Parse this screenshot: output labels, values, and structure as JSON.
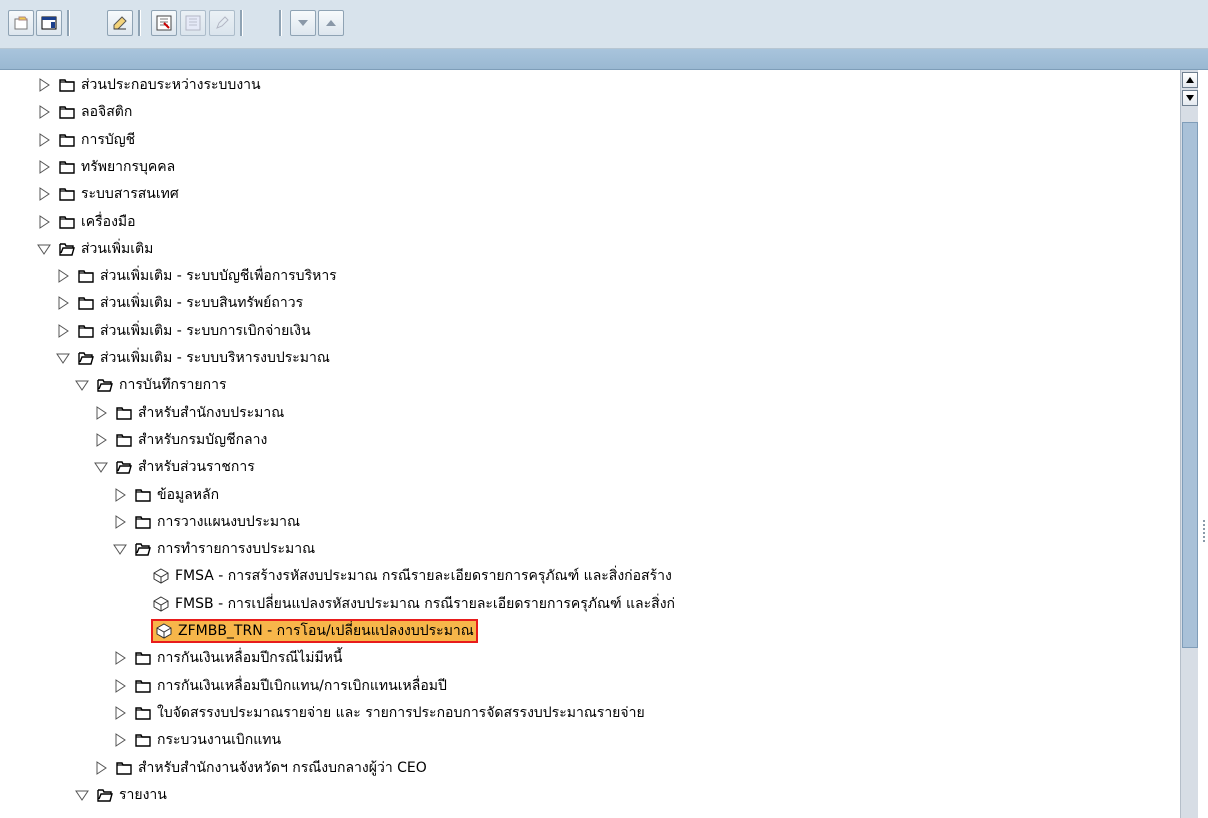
{
  "toolbar": {
    "buttons": [
      {
        "name": "open-folder-icon"
      },
      {
        "name": "favorites-icon"
      },
      {
        "name": "pencil-erase-icon"
      },
      {
        "name": "add-favorite-icon"
      },
      {
        "name": "change-favorite-icon"
      },
      {
        "name": "edit-pencil-icon"
      },
      {
        "name": "move-down-icon"
      },
      {
        "name": "move-up-icon"
      }
    ]
  },
  "tree": {
    "nodes": [
      {
        "label": "ส่วนประกอบระหว่างระบบงาน",
        "level": 0,
        "type": "folder",
        "expanded": false
      },
      {
        "label": "ลอจิสติก",
        "level": 0,
        "type": "folder",
        "expanded": false
      },
      {
        "label": "การบัญชี",
        "level": 0,
        "type": "folder",
        "expanded": false
      },
      {
        "label": "ทรัพยากรบุคคล",
        "level": 0,
        "type": "folder",
        "expanded": false
      },
      {
        "label": "ระบบสารสนเทศ",
        "level": 0,
        "type": "folder",
        "expanded": false
      },
      {
        "label": "เครื่องมือ",
        "level": 0,
        "type": "folder",
        "expanded": false
      },
      {
        "label": "ส่วนเพิ่มเติม",
        "level": 0,
        "type": "folder",
        "expanded": true
      },
      {
        "label": "ส่วนเพิ่มเติม - ระบบบัญชีเพื่อการบริหาร",
        "level": 1,
        "type": "folder",
        "expanded": false
      },
      {
        "label": "ส่วนเพิ่มเติม - ระบบสินทรัพย์ถาวร",
        "level": 1,
        "type": "folder",
        "expanded": false
      },
      {
        "label": "ส่วนเพิ่มเติม - ระบบการเบิกจ่ายเงิน",
        "level": 1,
        "type": "folder",
        "expanded": false
      },
      {
        "label": "ส่วนเพิ่มเติม - ระบบบริหารงบประมาณ",
        "level": 1,
        "type": "folder",
        "expanded": true
      },
      {
        "label": "การบันทึกรายการ",
        "level": 2,
        "type": "folder",
        "expanded": true
      },
      {
        "label": "สำหรับสำนักงบประมาณ",
        "level": 3,
        "type": "folder",
        "expanded": false
      },
      {
        "label": "สำหรับกรมบัญชีกลาง",
        "level": 3,
        "type": "folder",
        "expanded": false
      },
      {
        "label": "สำหรับส่วนราชการ",
        "level": 3,
        "type": "folder",
        "expanded": true
      },
      {
        "label": "ข้อมูลหลัก",
        "level": 4,
        "type": "folder",
        "expanded": false
      },
      {
        "label": "การวางแผนงบประมาณ",
        "level": 4,
        "type": "folder",
        "expanded": false
      },
      {
        "label": "การทำรายการงบประมาณ",
        "level": 4,
        "type": "folder",
        "expanded": true
      },
      {
        "label": "FMSA - การสร้างรหัสงบประมาณ กรณีรายละเอียดรายการครุภัณฑ์ และสิ่งก่อสร้าง",
        "level": 5,
        "type": "transaction",
        "selected": false
      },
      {
        "label": "FMSB - การเปลี่ยนแปลงรหัสงบประมาณ กรณีรายละเอียดรายการครุภัณฑ์ และสิ่งก่",
        "level": 5,
        "type": "transaction",
        "selected": false
      },
      {
        "label": "ZFMBB_TRN - การโอน/เปลี่ยนแปลงงบประมาณ",
        "level": 5,
        "type": "transaction",
        "selected": true
      },
      {
        "label": "การกันเงินเหลื่อมปีกรณีไม่มีหนี้",
        "level": 4,
        "type": "folder",
        "expanded": false
      },
      {
        "label": "การกันเงินเหลื่อมปีเบิกแทน/การเบิกแทนเหลื่อมปี",
        "level": 4,
        "type": "folder",
        "expanded": false
      },
      {
        "label": "ใบจัดสรรงบประมาณรายจ่าย และ รายการประกอบการจัดสรรงบประมาณรายจ่าย",
        "level": 4,
        "type": "folder",
        "expanded": false
      },
      {
        "label": "กระบวนงานเบิกแทน",
        "level": 4,
        "type": "folder",
        "expanded": false
      },
      {
        "label": "สำหรับสำนักงานจังหวัดฯ กรณีงบกลางผู้ว่า CEO",
        "level": 3,
        "type": "folder",
        "expanded": false
      },
      {
        "label": "รายงาน",
        "level": 2,
        "type": "folder",
        "expanded": true
      }
    ]
  },
  "colors": {
    "selection_fill": "#f7b64a",
    "selection_border": "#e81b1b",
    "header_bar": "#9ab8d2",
    "toolbar_bg": "#d8e3ec"
  }
}
